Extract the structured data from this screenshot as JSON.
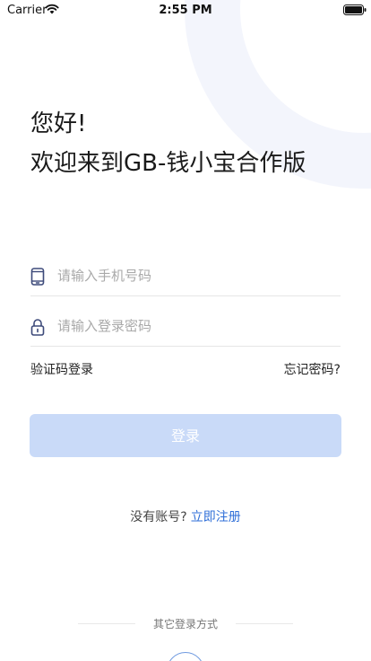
{
  "status_bar": {
    "carrier": "Carrier",
    "time": "2:55 PM"
  },
  "greeting": {
    "line1": "您好!",
    "line2": "欢迎来到GB-钱小宝合作版"
  },
  "form": {
    "phone_placeholder": "请输入手机号码",
    "password_placeholder": "请输入登录密码",
    "sms_login_label": "验证码登录",
    "forgot_password_label": "忘记密码?",
    "login_button_label": "登录"
  },
  "register": {
    "prompt": "没有账号?",
    "link_label": "立即注册"
  },
  "other_login": {
    "label": "其它登录方式"
  },
  "colors": {
    "accent": "#2f6fd8",
    "button_disabled": "#c9daf8",
    "icon": "#3d4a7a"
  }
}
